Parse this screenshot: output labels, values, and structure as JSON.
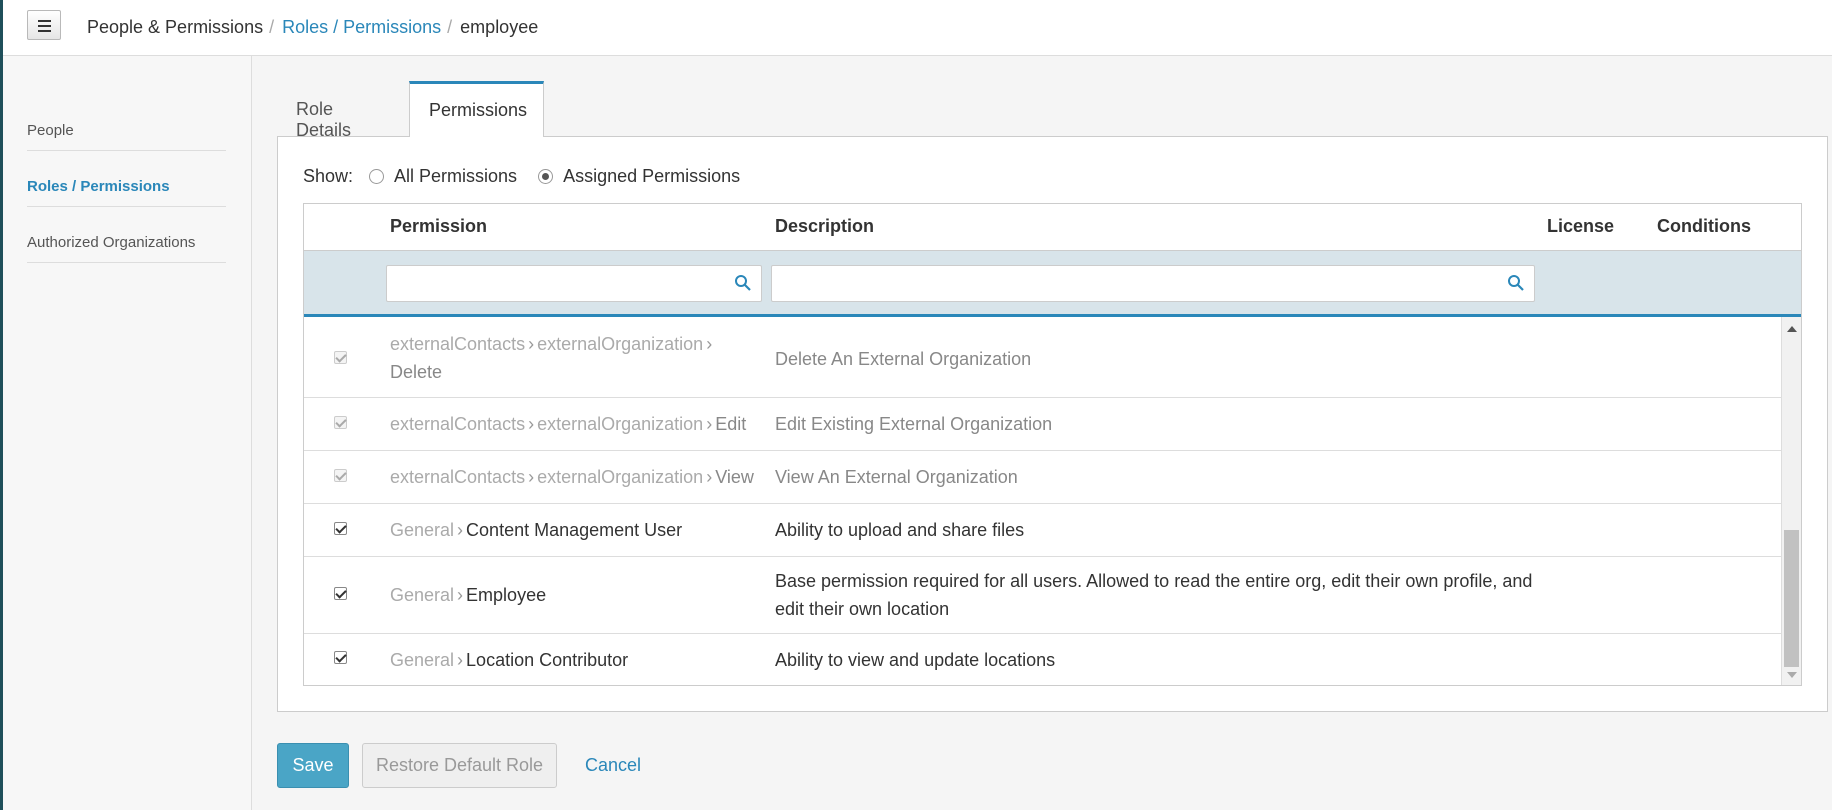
{
  "header": {
    "breadcrumb": [
      "People & Permissions",
      "Roles / Permissions",
      "employee"
    ],
    "separator": "/"
  },
  "sidebar": {
    "items": [
      {
        "label": "People"
      },
      {
        "label": "Roles / Permissions"
      },
      {
        "label": "Authorized Organizations"
      }
    ]
  },
  "tabs": [
    {
      "label": "Role Details"
    },
    {
      "label": "Permissions"
    }
  ],
  "filter": {
    "show_label": "Show:",
    "options": [
      "All Permissions",
      "Assigned Permissions"
    ],
    "selected": "Assigned Permissions"
  },
  "table": {
    "columns": [
      "Permission",
      "Description",
      "License",
      "Conditions"
    ],
    "rows": [
      {
        "path": [
          "externalContacts",
          "externalOrganization"
        ],
        "leaf": "Delete",
        "description": "Delete An External Organization"
      },
      {
        "path": [
          "externalContacts",
          "externalOrganization"
        ],
        "leaf": "Edit",
        "description": "Edit Existing External Organization"
      },
      {
        "path": [
          "externalContacts",
          "externalOrganization"
        ],
        "leaf": "View",
        "description": "View An External Organization"
      },
      {
        "path": [
          "General"
        ],
        "leaf": "Content Management User",
        "description": "Ability to upload and share files"
      },
      {
        "path": [
          "General"
        ],
        "leaf": "Employee",
        "description": "Base permission required for all users. Allowed to read the entire org, edit their own profile, and edit their own location"
      },
      {
        "path": [
          "General"
        ],
        "leaf": "Location Contributor",
        "description": "Ability to view and update locations"
      }
    ]
  },
  "actions": {
    "save": "Save",
    "restore": "Restore Default Role",
    "cancel": "Cancel"
  },
  "colors": {
    "accent": "#2a87b9",
    "save_button": "#4aa5c6",
    "filter_row": "#d8e4ea"
  }
}
